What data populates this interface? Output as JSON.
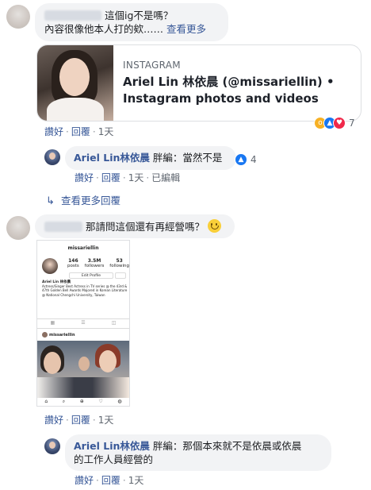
{
  "comment1": {
    "text_line1": "這個ig不是嗎？",
    "text_line2": "內容很像他本人打的欸……",
    "see_more": "查看更多"
  },
  "link_preview": {
    "source": "INSTAGRAM",
    "title": "Ariel Lin 林依晨 (@missariellin) • Instagram photos and videos"
  },
  "comment1_actions": {
    "like": "讚好",
    "reply": "回覆",
    "time": "1天"
  },
  "comment1_reactions": {
    "icons": [
      "wow-icon",
      "like-icon",
      "love-icon"
    ],
    "count": "7"
  },
  "reply1": {
    "name": "Ariel Lin林依晨",
    "text": "胖編：當然不是",
    "reaction_count": "4",
    "actions": {
      "like": "讚好",
      "reply": "回覆",
      "time": "1天",
      "edited": "已編輯"
    }
  },
  "more_replies": "查看更多回覆",
  "comment2": {
    "text": "那請問這個還有再經營嗎？",
    "emoji": "smile-emoji"
  },
  "ig_screenshot": {
    "username": "missariellin",
    "stats": [
      {
        "value": "146",
        "label": "posts"
      },
      {
        "value": "3.5M",
        "label": "followers"
      },
      {
        "value": "53",
        "label": "following"
      }
    ],
    "button": "Edit Profile",
    "bio_name": "Ariel Lin 林依晨",
    "bio_text": "Actress/Singer Best Actress in TV series @ the 43rd & 47th Golden Bell Awards Majored in Korean Literature @ National Chengchi University, Taiwan",
    "post_user": "missariellin"
  },
  "comment2_actions": {
    "like": "讚好",
    "reply": "回覆",
    "time": "1天"
  },
  "reply2": {
    "name": "Ariel Lin林依晨",
    "text_line1": "胖編：那個本來就不是依晨或依晨",
    "text_line2": "的工作人員經營的",
    "actions": {
      "like": "讚好",
      "reply": "回覆",
      "time": "1天"
    }
  },
  "colors": {
    "link": "#385898",
    "bubble": "#f2f3f5",
    "like_blue": "#1877f2",
    "love_red": "#f0284a",
    "wow_yellow": "#f7b125"
  }
}
